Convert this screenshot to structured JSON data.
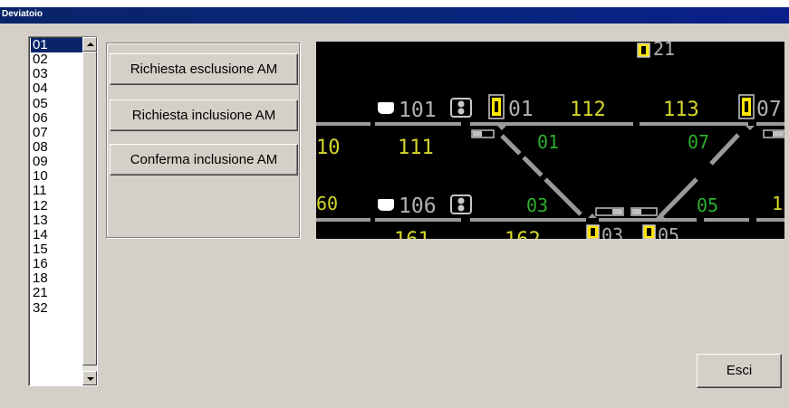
{
  "window": {
    "title": "Deviatoio"
  },
  "list": {
    "items": [
      "01",
      "02",
      "03",
      "04",
      "05",
      "06",
      "07",
      "08",
      "09",
      "10",
      "11",
      "12",
      "13",
      "14",
      "15",
      "16",
      "18",
      "21",
      "32"
    ],
    "selected": "01"
  },
  "buttons": {
    "esclusione": "Richiesta esclusione AM",
    "inclusione": "Richiesta inclusione AM",
    "conferma": "Conferma inclusione AM",
    "esci": "Esci"
  },
  "track": {
    "labels": {
      "top_signal": "21",
      "sig_101": "101",
      "sig_01": "01",
      "sec_112": "112",
      "sec_113": "113",
      "sig_07": "07",
      "sec_10": "10",
      "sec_111": "111",
      "sw_01": "01",
      "sw_07": "07",
      "sec_60": "60",
      "sig_106": "106",
      "sw_03": "03",
      "sw_05": "05",
      "sec_1": "1",
      "sec_161": "161",
      "sec_162": "162",
      "sig_03": "03",
      "sig_05": "05"
    },
    "colors": {
      "background": "#000000",
      "track": "#9a9a9a",
      "yellow_label": "#d6d62a",
      "green_label": "#2fae2f",
      "gray_label": "#b0b0b0",
      "signal_yellow": "#ffe600"
    }
  }
}
